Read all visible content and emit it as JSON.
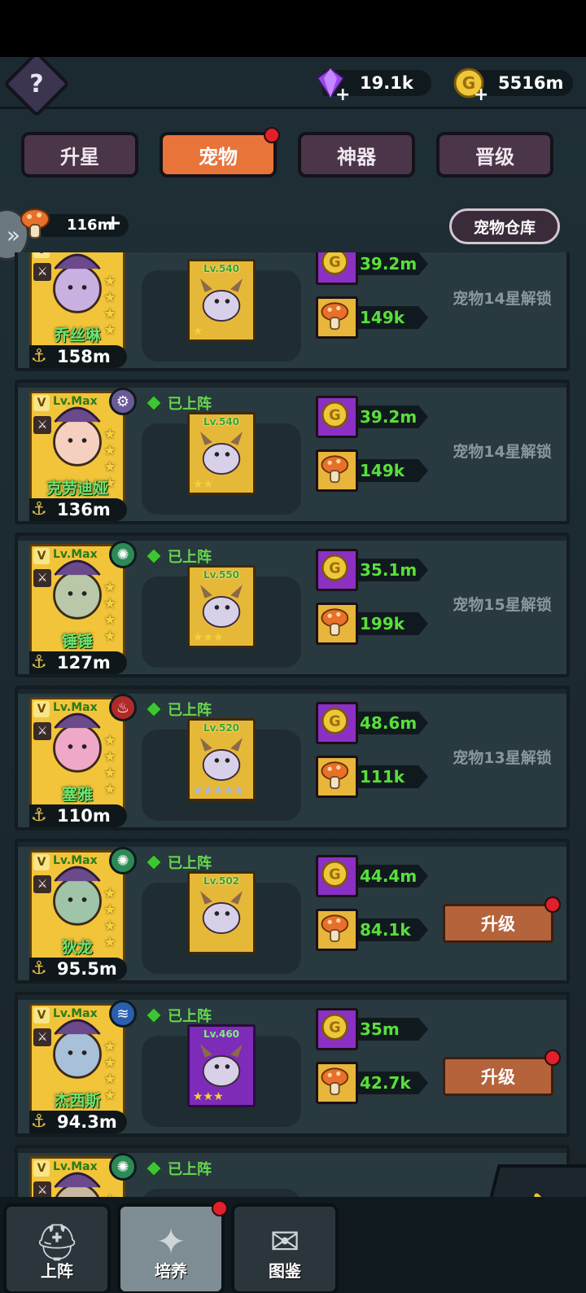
{
  "currencies": {
    "gems": "19.1k",
    "gold": "5516m",
    "mushroom": "116m"
  },
  "tabs": [
    {
      "label": "升星",
      "active": false,
      "badge": false
    },
    {
      "label": "宠物",
      "active": true,
      "badge": true
    },
    {
      "label": "神器",
      "active": false,
      "badge": false
    },
    {
      "label": "晋级",
      "active": false,
      "badge": false
    }
  ],
  "storage_button": "宠物仓库",
  "deployed_label": "已上阵",
  "lv_max_label": "Lv.Max",
  "v_badge": "V",
  "upgrade_label": "升级",
  "rows": [
    {
      "name": "乔丝琳",
      "power": "158m",
      "pet_lv": "Lv.540",
      "gold_cost": "39.2m",
      "mush_cost": "149k",
      "status": "宠物14星解锁",
      "deployed": false,
      "element": "",
      "element_color": "#7a6aa8",
      "pet_stars": "★",
      "upgradable": false,
      "pet_purple": false
    },
    {
      "name": "克劳迪娅",
      "power": "136m",
      "pet_lv": "Lv.540",
      "gold_cost": "39.2m",
      "mush_cost": "149k",
      "status": "宠物14星解锁",
      "deployed": true,
      "element": "gear-icon",
      "element_color": "#6a5b98",
      "pet_stars": "★★",
      "upgradable": false,
      "pet_purple": false
    },
    {
      "name": "锤锤",
      "power": "127m",
      "pet_lv": "Lv.550",
      "gold_cost": "35.1m",
      "mush_cost": "199k",
      "status": "宠物15星解锁",
      "deployed": true,
      "element": "wind-icon",
      "element_color": "#2b8a55",
      "pet_stars": "★★★",
      "upgradable": false,
      "pet_purple": false
    },
    {
      "name": "塞雅",
      "power": "110m",
      "pet_lv": "Lv.520",
      "gold_cost": "48.6m",
      "mush_cost": "111k",
      "status": "宠物13星解锁",
      "deployed": true,
      "element": "fire-icon",
      "element_color": "#b02a2a",
      "pet_stars": "★★★★★",
      "upgradable": false,
      "pet_purple": false
    },
    {
      "name": "狄龙",
      "power": "95.5m",
      "pet_lv": "Lv.502",
      "gold_cost": "44.4m",
      "mush_cost": "84.1k",
      "status": "",
      "deployed": true,
      "element": "wind-icon",
      "element_color": "#2b8a55",
      "pet_stars": "",
      "upgradable": true,
      "pet_purple": false
    },
    {
      "name": "杰西斯",
      "power": "94.3m",
      "pet_lv": "Lv.460",
      "gold_cost": "35m",
      "mush_cost": "42.7k",
      "status": "",
      "deployed": true,
      "element": "water-icon",
      "element_color": "#2a5fb0",
      "pet_stars": "★★★",
      "upgradable": true,
      "pet_purple": true
    },
    {
      "name": "",
      "power": "",
      "pet_lv": "",
      "gold_cost": "",
      "mush_cost": "",
      "status": "",
      "deployed": true,
      "element": "wind-icon",
      "element_color": "#2b8a55",
      "pet_stars": "",
      "upgradable": false,
      "pet_purple": true
    }
  ],
  "bottom_nav": [
    {
      "label": "上阵",
      "icon": "helmet-icon",
      "active": false,
      "badge": false
    },
    {
      "label": "培养",
      "icon": "star-icon",
      "active": true,
      "badge": true
    },
    {
      "label": "图鉴",
      "icon": "book-icon",
      "active": false,
      "badge": false
    }
  ],
  "colors": {
    "accent": "#e8743a",
    "green_text": "#58e03a",
    "badge_red": "#e0202a"
  }
}
